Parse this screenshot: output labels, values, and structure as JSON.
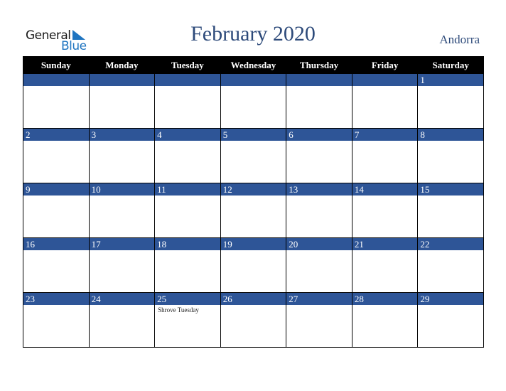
{
  "logo": {
    "line1": "General",
    "line2": "Blue"
  },
  "title": "February 2020",
  "country": "Andorra",
  "colors": {
    "header_bg": "#000000",
    "day_bar": "#2e5597",
    "title": "#2d4a7a",
    "logo_blue": "#1e74c0"
  },
  "weekdays": [
    "Sunday",
    "Monday",
    "Tuesday",
    "Wednesday",
    "Thursday",
    "Friday",
    "Saturday"
  ],
  "weeks": [
    [
      {
        "day": ""
      },
      {
        "day": ""
      },
      {
        "day": ""
      },
      {
        "day": ""
      },
      {
        "day": ""
      },
      {
        "day": ""
      },
      {
        "day": "1"
      }
    ],
    [
      {
        "day": "2"
      },
      {
        "day": "3"
      },
      {
        "day": "4"
      },
      {
        "day": "5"
      },
      {
        "day": "6"
      },
      {
        "day": "7"
      },
      {
        "day": "8"
      }
    ],
    [
      {
        "day": "9"
      },
      {
        "day": "10"
      },
      {
        "day": "11"
      },
      {
        "day": "12"
      },
      {
        "day": "13"
      },
      {
        "day": "14"
      },
      {
        "day": "15"
      }
    ],
    [
      {
        "day": "16"
      },
      {
        "day": "17"
      },
      {
        "day": "18"
      },
      {
        "day": "19"
      },
      {
        "day": "20"
      },
      {
        "day": "21"
      },
      {
        "day": "22"
      }
    ],
    [
      {
        "day": "23"
      },
      {
        "day": "24"
      },
      {
        "day": "25",
        "event": "Shrove Tuesday"
      },
      {
        "day": "26"
      },
      {
        "day": "27"
      },
      {
        "day": "28"
      },
      {
        "day": "29"
      }
    ]
  ]
}
